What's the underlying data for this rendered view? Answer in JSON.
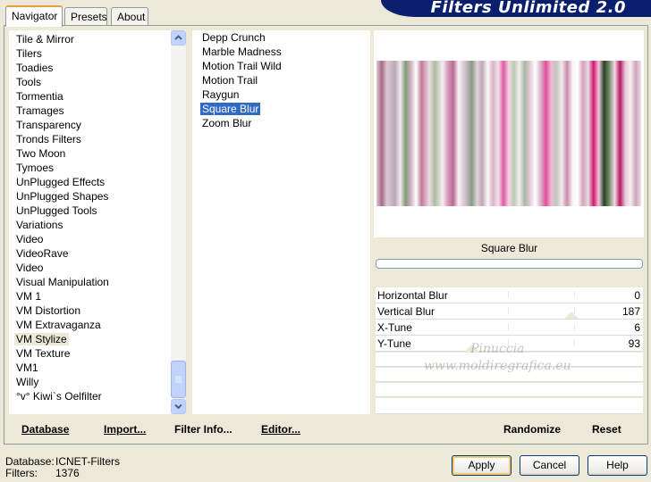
{
  "app": {
    "title": "Filters Unlimited 2.0"
  },
  "tabs": [
    {
      "label": "Navigator",
      "active": true
    },
    {
      "label": "Presets",
      "active": false
    },
    {
      "label": "About",
      "active": false
    }
  ],
  "categories": [
    "Tile & Mirror",
    "Tilers",
    "Toadies",
    "Tools",
    "Tormentia",
    "Tramages",
    "Transparency",
    "Tronds Filters",
    "Two Moon",
    "Tymoes",
    "UnPlugged Effects",
    "UnPlugged Shapes",
    "UnPlugged Tools",
    "Variations",
    "Video",
    "VideoRave",
    "Video",
    "Visual Manipulation",
    "VM 1",
    "VM Distortion",
    "VM Extravaganza",
    "VM Stylize",
    "VM Texture",
    "VM1",
    "Willy",
    "°v° Kiwi`s Oelfilter"
  ],
  "selected_category": "VM Stylize",
  "filters": [
    "Depp Crunch",
    "Marble Madness",
    "Motion Trail Wild",
    "Motion Trail",
    "Raygun",
    "Square Blur",
    "Zoom Blur"
  ],
  "selected_filter": "Square Blur",
  "left_toolbar": {
    "database": "Database",
    "import": "Import...",
    "filter_info": "Filter Info...",
    "editor": "Editor..."
  },
  "preview": {
    "filter_name": "Square Blur",
    "watermark_line1": "Pinuccia",
    "watermark_line2": "www.moldiregrafica.eu"
  },
  "params": [
    {
      "name": "Horizontal Blur",
      "value": "0"
    },
    {
      "name": "Vertical Blur",
      "value": "187"
    },
    {
      "name": "X-Tune",
      "value": "6"
    },
    {
      "name": "Y-Tune",
      "value": "93"
    }
  ],
  "right_toolbar": {
    "randomize": "Randomize",
    "reset": "Reset"
  },
  "status": {
    "database_label": "Database:",
    "database_value": "ICNET-Filters",
    "filters_label": "Filters:",
    "filters_value": "1376"
  },
  "buttons": {
    "apply": "Apply",
    "cancel": "Cancel",
    "help": "Help"
  },
  "colors": {
    "banner": "#0a1e6e",
    "selection": "#316ac5",
    "dialog_bg": "#ece9d8"
  }
}
